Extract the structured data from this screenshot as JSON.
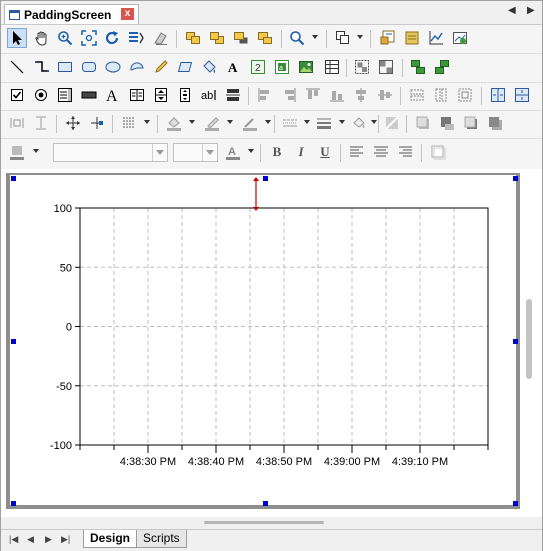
{
  "document_tab": {
    "title": "PaddingScreen",
    "close_glyph": "x"
  },
  "tab_nav": {
    "prev_glyph": "◀",
    "next_glyph": "▶"
  },
  "toolbar": {
    "row1": [
      "pointer-icon",
      "hand-pan-icon",
      "zoom-in-icon",
      "zoom-fit-icon",
      "refresh-icon",
      "list-properties-icon",
      "eraser-icon",
      "bring-forward-icon",
      "send-backward-icon",
      "bring-to-front-icon",
      "send-to-back-icon",
      "find-icon",
      "duplicate-icon",
      "screen-properties-icon",
      "database-icon",
      "trend-chart-icon",
      "chart-check-icon"
    ],
    "row2": [
      "line-icon",
      "polyline-icon",
      "rectangle-icon",
      "rounded-rectangle-icon",
      "ellipse-icon",
      "arc-icon",
      "pencil-icon",
      "parallelogram-icon",
      "paint-bucket-icon",
      "text-icon",
      "numeric-field-icon",
      "alarm-field-icon",
      "image-icon",
      "table-icon",
      "group-icon",
      "ungroup-icon",
      "align-objects-icon",
      "distribute-objects-icon"
    ],
    "row3": [
      "checkbox-icon",
      "radio-button-icon",
      "listbox-icon",
      "button-icon",
      "label-text-icon",
      "grid-text-icon",
      "spinner-icon",
      "text-input-icon",
      "scroll-control-icon",
      "align-left-icon",
      "align-right-icon",
      "align-top-icon",
      "align-bottom-icon",
      "align-center-h-icon",
      "align-center-v-icon",
      "same-width-icon",
      "same-height-icon",
      "same-size-icon",
      "space-horizontal-icon",
      "space-vertical-icon"
    ],
    "row4": [
      "center-horizontal-icon",
      "center-vertical-icon",
      "move-icon",
      "snap-icon",
      "grid-dots-icon",
      "fill-color-icon",
      "line-color-icon",
      "pen-color-icon",
      "line-style-icon",
      "line-width-icon",
      "fill-pattern-icon",
      "transparency-icon",
      "shadow-icon",
      "depth-icon",
      "shadow-offset-icon"
    ],
    "row5": {
      "shape-fill": "shape-fill-icon",
      "font_name": "",
      "font_size": "",
      "font_color": "font-color-icon",
      "bold_label": "B",
      "italic_label": "I",
      "underline_label": "U",
      "align_left": "text-align-left-icon",
      "align_center": "text-align-center-icon",
      "align_right": "text-align-right-icon",
      "frame": "frame-icon"
    }
  },
  "chart_data": {
    "type": "line",
    "title": "",
    "xlabel": "",
    "ylabel": "",
    "ylim": [
      -100,
      100
    ],
    "y_ticks": [
      "100",
      "50",
      "0",
      "-50",
      "-100"
    ],
    "x_ticks": [
      "4:38:30 PM",
      "4:38:40 PM",
      "4:38:50 PM",
      "4:39:00 PM",
      "4:39:10 PM"
    ],
    "grid": true,
    "series": []
  },
  "bottom_nav": {
    "first": "|◀",
    "prev": "◀",
    "next": "▶",
    "last": "▶|"
  },
  "bottom_tabs": [
    {
      "label": "Design",
      "active": true
    },
    {
      "label": "Scripts",
      "active": false
    }
  ],
  "colors": {
    "selection_handle": "#0000cc",
    "padding_arrow": "#cc0000",
    "frame": "#8e8e8e"
  }
}
